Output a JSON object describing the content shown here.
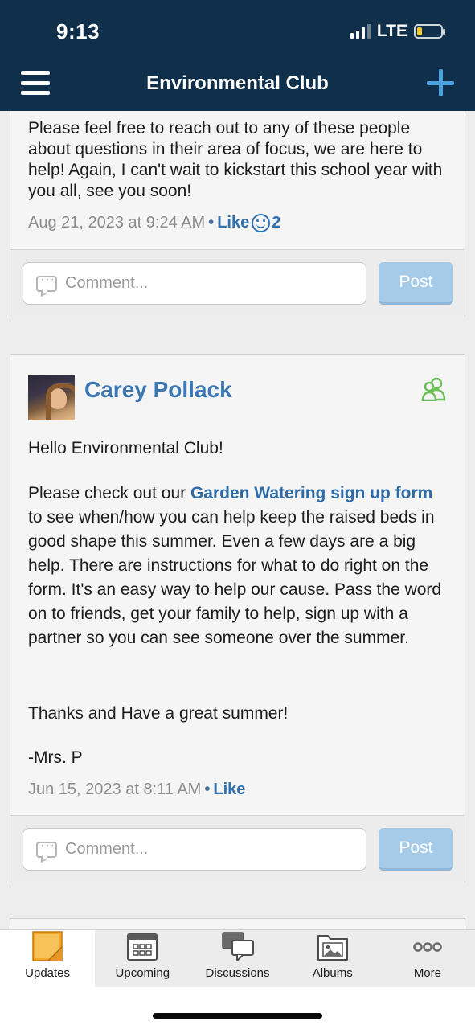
{
  "status_bar": {
    "time": "9:13",
    "network": "LTE"
  },
  "header": {
    "title": "Environmental Club"
  },
  "post1": {
    "body": "Please feel free to reach out to any of these people about questions in their area of focus, we are here to help! Again, I can't wait to kickstart this school year with you all, see you soon!",
    "timestamp": "Aug 21, 2023 at 9:24 AM",
    "separator": "•",
    "like_label": "Like",
    "like_count": "2",
    "comment_placeholder": "Comment...",
    "post_label": "Post"
  },
  "post2": {
    "author": "Carey Pollack",
    "greeting": "Hello Environmental Club!",
    "para_before_link": "Please check out our ",
    "link_text": "Garden Watering sign up form",
    "para_after_link": " to see when/how you can help keep the raised beds in good shape this summer.  Even a few days are a big help. There are instructions for what to do right on the form. It's an easy way to help our cause. Pass the word on to friends, get your family to help, sign up with a partner so you can see someone over the summer.",
    "closing": "Thanks and Have a great summer!",
    "signature": "-Mrs. P",
    "timestamp": "Jun 15, 2023 at 8:11 AM",
    "separator": "•",
    "like_label": "Like",
    "comment_placeholder": "Comment...",
    "post_label": "Post"
  },
  "tabs": [
    {
      "label": "Updates",
      "icon": "sticky-note-icon",
      "active": true
    },
    {
      "label": "Upcoming",
      "icon": "calendar-icon",
      "active": false
    },
    {
      "label": "Discussions",
      "icon": "chat-bubbles-icon",
      "active": false
    },
    {
      "label": "Albums",
      "icon": "photo-album-icon",
      "active": false
    },
    {
      "label": "More",
      "icon": "more-dots-icon",
      "active": false
    }
  ],
  "colors": {
    "header_bg": "#0f2f4a",
    "accent_blue": "#3b77b3",
    "plus_blue": "#4aa3df",
    "post_button": "#a6cbe8",
    "group_icon_green": "#6fbf5a",
    "updates_icon_orange": "#f5a623"
  }
}
